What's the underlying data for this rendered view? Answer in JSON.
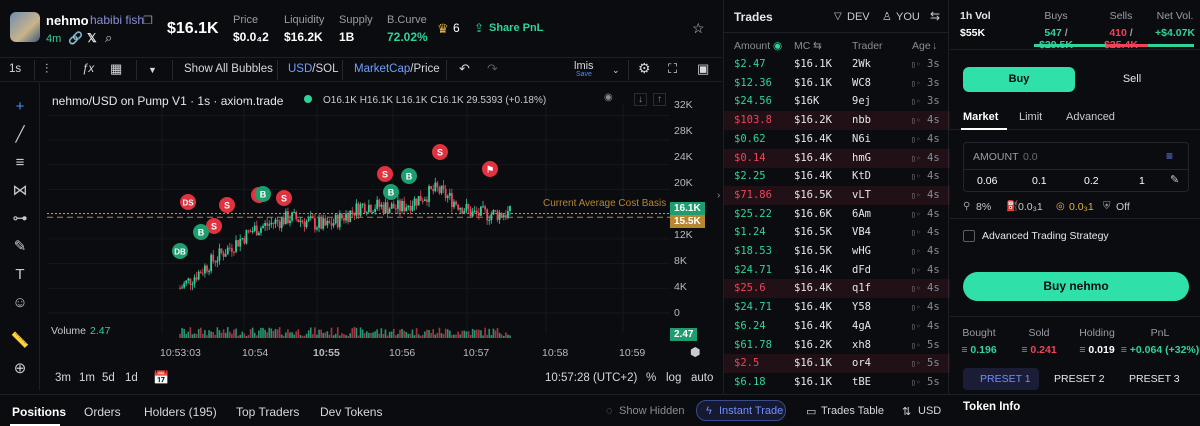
{
  "token": {
    "name": "nehmo",
    "full_name": "habibi fish",
    "age": "4m",
    "market_cap": "$16.1K",
    "stats": [
      {
        "label": "Price",
        "value": "$0.0₄2"
      },
      {
        "label": "Liquidity",
        "value": "$16.2K"
      },
      {
        "label": "Supply",
        "value": "1B"
      },
      {
        "label": "B.Curve",
        "value": "72.02%"
      }
    ],
    "crown_count": "6",
    "share_label": "Share PnL"
  },
  "toolbar": {
    "interval": "1s",
    "show_all_bubbles": "Show All Bubbles",
    "usd": "USD",
    "sol": "SOL",
    "marketcap": "MarketCap",
    "price": "Price",
    "layout_name": "lmis",
    "save": "Save"
  },
  "chart": {
    "title": "nehmo/USD on Pump V1 · 1s · axiom.trade",
    "ohlc": "O16.1K H16.1K L16.1K C16.1K 29.5393 (+0.18%)",
    "y_ticks": [
      "32K",
      "28K",
      "24K",
      "20K",
      "16K",
      "12K",
      "8K",
      "4K",
      "0"
    ],
    "x_ticks": [
      "10:53:03",
      "10:54",
      "10:55",
      "10:56",
      "10:57",
      "10:58",
      "10:59"
    ],
    "current_label": "16.1K",
    "avg_label": "15.5K",
    "avg_text": "Current Average Cost Basis",
    "volume_label": "Volume",
    "volume_value": "2.47",
    "volume_tag": "2.47",
    "markers": [
      "DS",
      "S",
      "S",
      "B",
      "DB",
      "S",
      "B",
      "S",
      "B"
    ]
  },
  "chart_data": {
    "type": "line",
    "title": "nehmo/USD on Pump V1 · 1s · axiom.trade",
    "xlabel": "",
    "ylabel": "",
    "x": [
      "10:53:03",
      "10:53:30",
      "10:54",
      "10:54:30",
      "10:55",
      "10:55:30",
      "10:56",
      "10:56:30",
      "10:57",
      "10:57:20"
    ],
    "series": [
      {
        "values": [
          4000,
          9000,
          13500,
          15500,
          14000,
          17500,
          17000,
          20000,
          16000,
          16100
        ]
      }
    ],
    "ylim": [
      0,
      34000
    ],
    "grid": true
  },
  "bottombar": {
    "ranges": [
      "3m",
      "1m",
      "5d",
      "1d"
    ],
    "time": "10:57:28 (UTC+2)",
    "pct": "%",
    "log": "log",
    "auto": "auto"
  },
  "tabs": {
    "items": [
      "Positions",
      "Orders",
      "Holders (195)",
      "Top Traders",
      "Dev Tokens"
    ],
    "show_hidden": "Show Hidden",
    "instant_trade": "Instant Trade",
    "trades_table": "Trades Table",
    "usd": "USD"
  },
  "trades": {
    "title": "Trades",
    "dev": "DEV",
    "you": "YOU",
    "cols": [
      "Amount",
      "MC",
      "Trader",
      "Age"
    ],
    "rows": [
      {
        "amount": "$2.47",
        "side": "buy",
        "mc": "$16.1K",
        "trader": "2Wk",
        "age": "3s"
      },
      {
        "amount": "$12.36",
        "side": "buy",
        "mc": "$16.1K",
        "trader": "WC8",
        "age": "3s"
      },
      {
        "amount": "$24.56",
        "side": "buy",
        "mc": "$16K",
        "trader": "9ej",
        "age": "3s"
      },
      {
        "amount": "$103.8",
        "side": "sell",
        "mc": "$16.2K",
        "trader": "nbb",
        "age": "4s"
      },
      {
        "amount": "$0.62",
        "side": "buy",
        "mc": "$16.4K",
        "trader": "N6i",
        "age": "4s"
      },
      {
        "amount": "$0.14",
        "side": "sell",
        "mc": "$16.4K",
        "trader": "hmG",
        "age": "4s"
      },
      {
        "amount": "$2.25",
        "side": "buy",
        "mc": "$16.4K",
        "trader": "KtD",
        "age": "4s"
      },
      {
        "amount": "$71.86",
        "side": "sell",
        "mc": "$16.5K",
        "trader": "vLT",
        "age": "4s"
      },
      {
        "amount": "$25.22",
        "side": "buy",
        "mc": "$16.6K",
        "trader": "6Am",
        "age": "4s"
      },
      {
        "amount": "$1.24",
        "side": "buy",
        "mc": "$16.5K",
        "trader": "VB4",
        "age": "4s"
      },
      {
        "amount": "$18.53",
        "side": "buy",
        "mc": "$16.5K",
        "trader": "wHG",
        "age": "4s"
      },
      {
        "amount": "$24.71",
        "side": "buy",
        "mc": "$16.4K",
        "trader": "dFd",
        "age": "4s"
      },
      {
        "amount": "$25.6",
        "side": "sell",
        "mc": "$16.4K",
        "trader": "q1f",
        "age": "4s"
      },
      {
        "amount": "$24.71",
        "side": "buy",
        "mc": "$16.4K",
        "trader": "Y58",
        "age": "4s"
      },
      {
        "amount": "$6.24",
        "side": "buy",
        "mc": "$16.4K",
        "trader": "4gA",
        "age": "4s"
      },
      {
        "amount": "$61.78",
        "side": "buy",
        "mc": "$16.2K",
        "trader": "xh8",
        "age": "5s"
      },
      {
        "amount": "$2.5",
        "side": "sell",
        "mc": "$16.1K",
        "trader": "or4",
        "age": "5s"
      },
      {
        "amount": "$6.18",
        "side": "buy",
        "mc": "$16.1K",
        "trader": "tBE",
        "age": "5s"
      }
    ]
  },
  "panel": {
    "vol_label": "1h Vol",
    "vol_value": "$55K",
    "buys_label": "Buys",
    "buys_count": "547",
    "buys_value": "$29.5K",
    "sells_label": "Sells",
    "sells_count": "410",
    "sells_value": "$25.4K",
    "netvol_label": "Net Vol.",
    "netvol_value": "+$4.07K",
    "buy_tab": "Buy",
    "sell_tab": "Sell",
    "order_tabs": [
      "Market",
      "Limit",
      "Advanced"
    ],
    "amount_label": "AMOUNT",
    "amount_placeholder": "0.0",
    "presets": [
      "0.06",
      "0.1",
      "0.2",
      "1"
    ],
    "slippage": "8%",
    "priority": "0.0₃1",
    "bribe": "0.0₃1",
    "mev": "Off",
    "advanced_strategy": "Advanced Trading Strategy",
    "buy_button": "Buy nehmo",
    "bought_label": "Bought",
    "bought_value": "0.196",
    "sold_label": "Sold",
    "sold_value": "0.241",
    "holding_label": "Holding",
    "holding_value": "0.019",
    "pnl_label": "PnL",
    "pnl_value": "+0.064 (+32%)",
    "preset_tabs": [
      "PRESET 1",
      "PRESET 2",
      "PRESET 3"
    ],
    "token_info": "Token Info"
  }
}
